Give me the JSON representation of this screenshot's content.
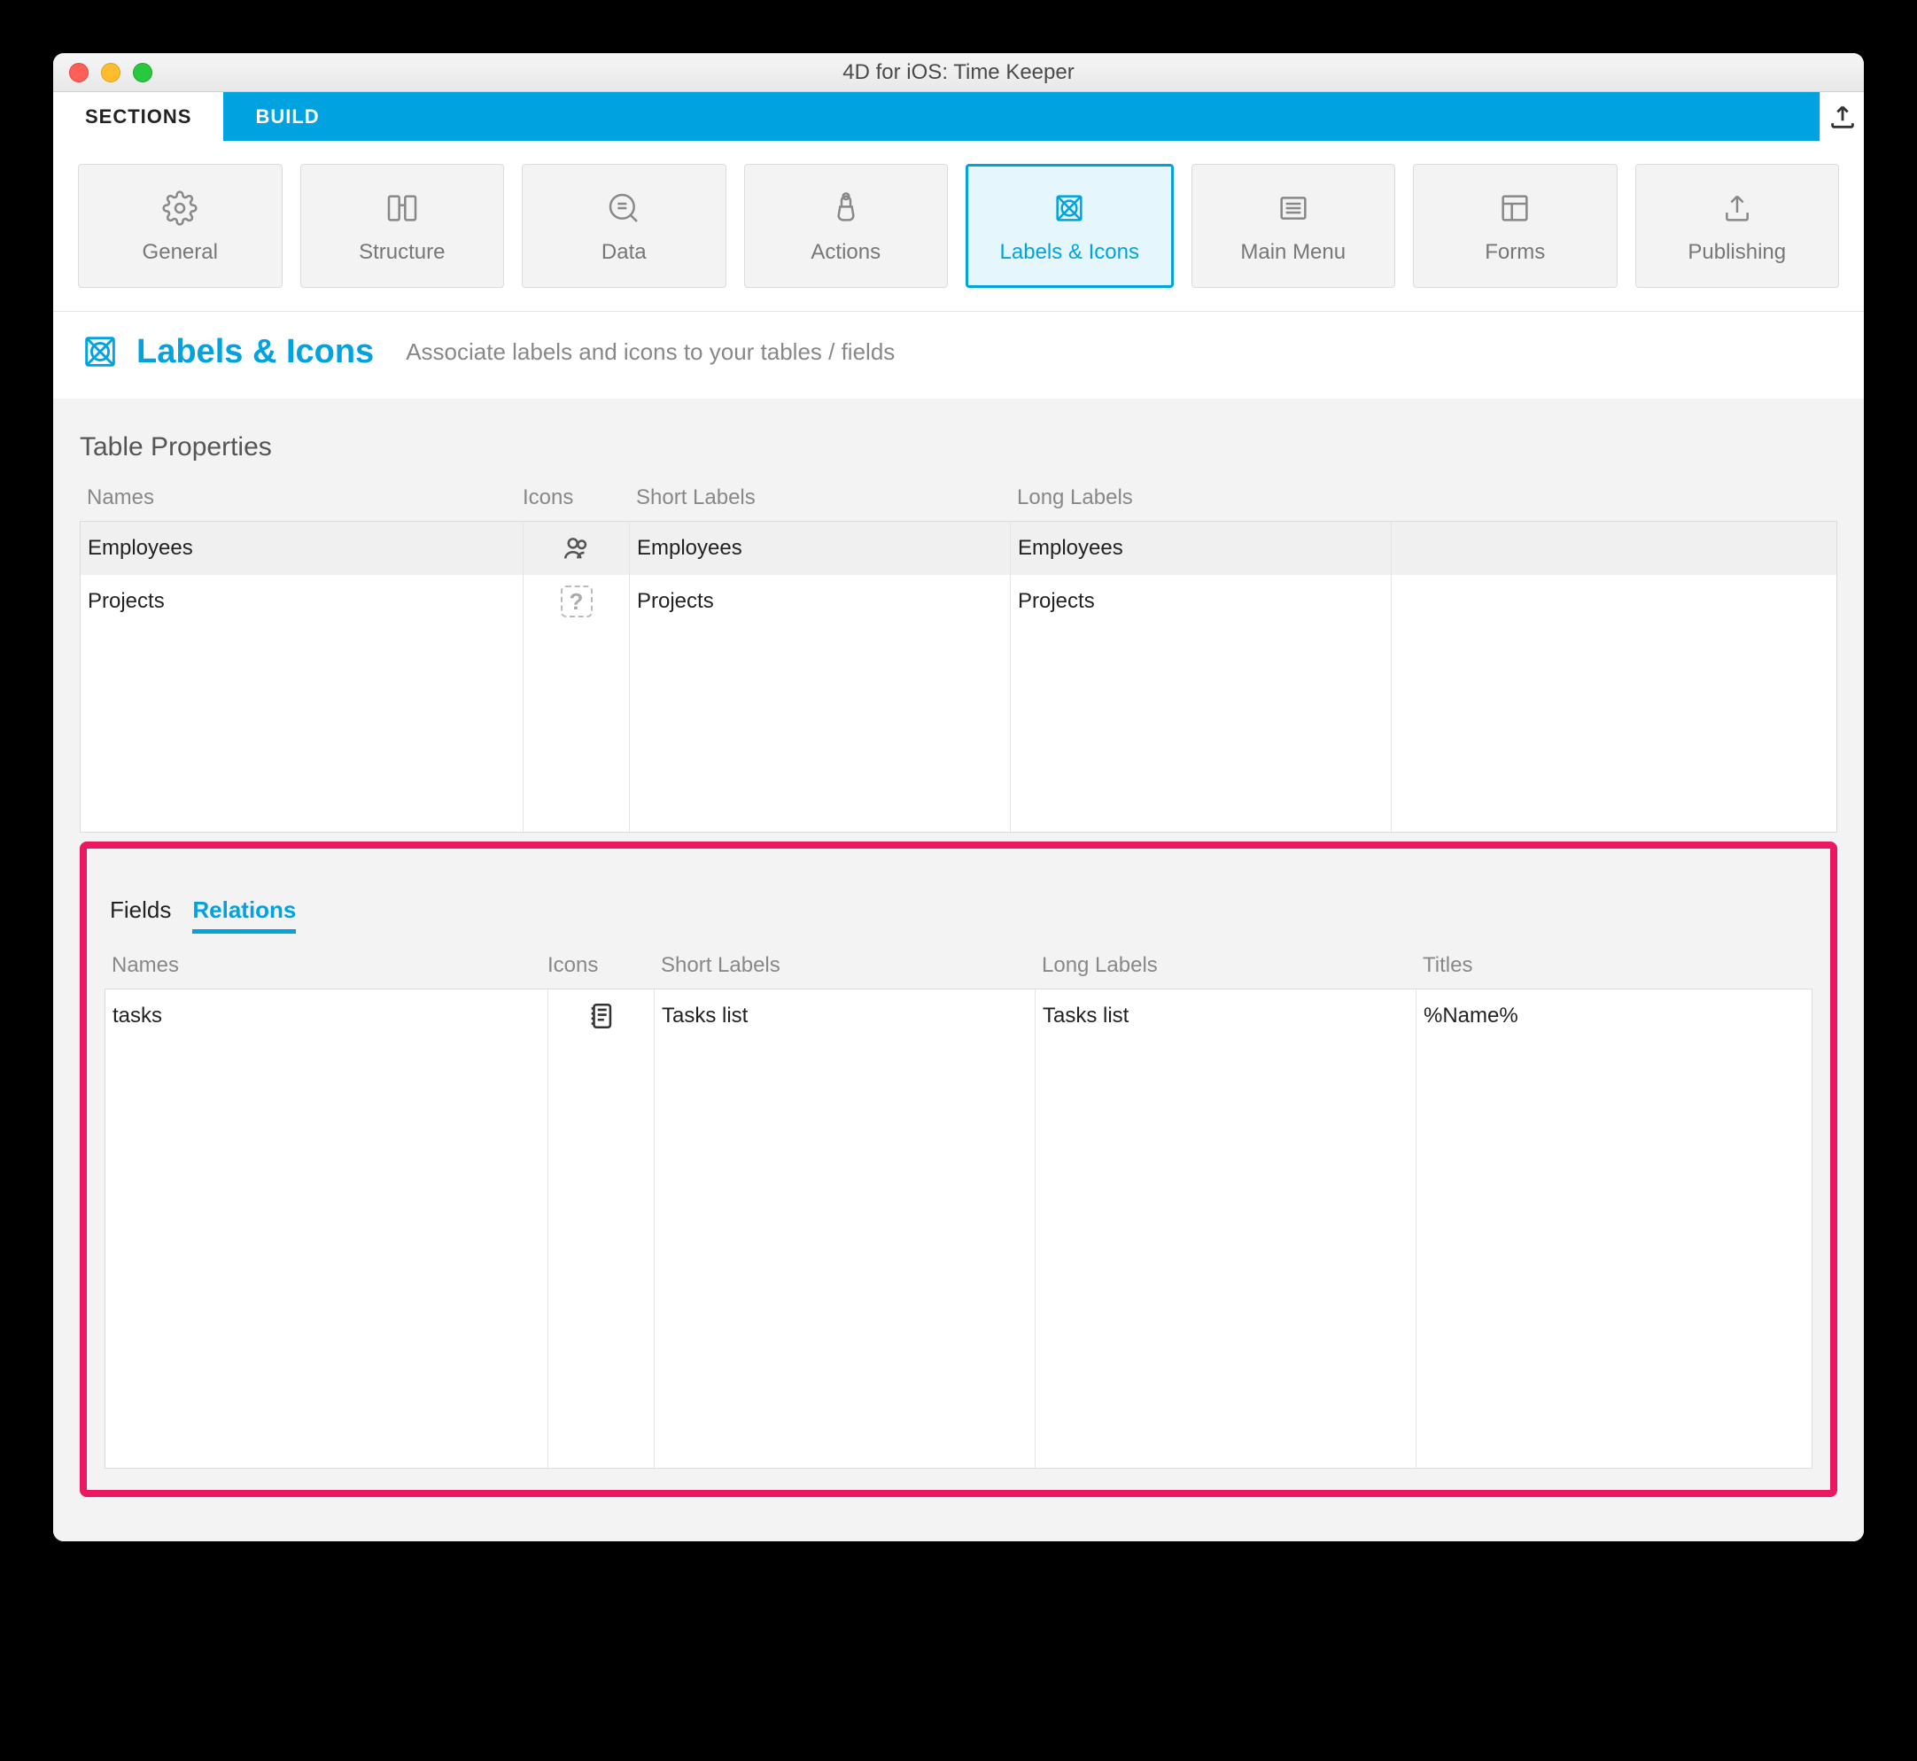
{
  "window": {
    "title": "4D for iOS: Time Keeper"
  },
  "topbar": {
    "sections": "SECTIONS",
    "build": "BUILD"
  },
  "tiles": {
    "general": "General",
    "structure": "Structure",
    "data": "Data",
    "actions": "Actions",
    "labels_icons": "Labels & Icons",
    "main_menu": "Main Menu",
    "forms": "Forms",
    "publishing": "Publishing"
  },
  "header": {
    "title": "Labels & Icons",
    "subtitle": "Associate labels and icons to your tables / fields"
  },
  "table_properties": {
    "title": "Table Properties",
    "columns": {
      "names": "Names",
      "icons": "Icons",
      "short": "Short Labels",
      "long": "Long Labels"
    },
    "rows": [
      {
        "name": "Employees",
        "short": "Employees",
        "long": "Employees",
        "icon": "people"
      },
      {
        "name": "Projects",
        "short": "Projects",
        "long": "Projects",
        "icon": "question"
      }
    ]
  },
  "subtabs": {
    "fields": "Fields",
    "relations": "Relations"
  },
  "relations": {
    "columns": {
      "names": "Names",
      "icons": "Icons",
      "short": "Short Labels",
      "long": "Long Labels",
      "titles": "Titles"
    },
    "rows": [
      {
        "name": "tasks",
        "short": "Tasks list",
        "long": "Tasks list",
        "title": "%Name%",
        "icon": "notebook"
      }
    ]
  }
}
